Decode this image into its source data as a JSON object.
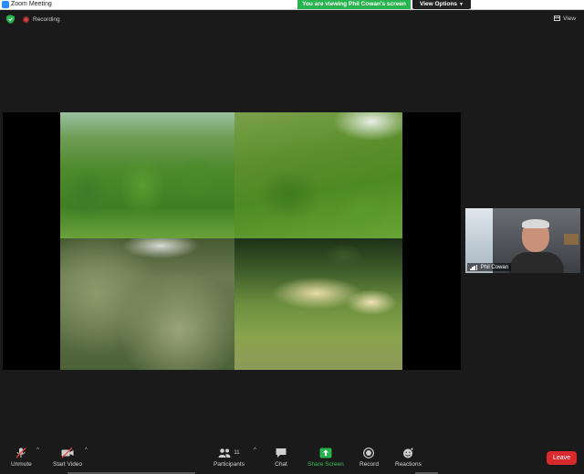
{
  "window": {
    "title": "Zoom Meeting"
  },
  "banner": {
    "text": "You are viewing Phil Cowan's screen"
  },
  "view_options": {
    "label": "View Options"
  },
  "top_bar": {
    "recording_label": "Recording",
    "view_label": "View"
  },
  "participant_video": {
    "name": "Phil Cowan"
  },
  "toolbar": {
    "unmute": "Unmute",
    "start_video": "Start Video",
    "participants": "Participants",
    "participants_count": "11",
    "chat": "Chat",
    "share_screen": "Share Screen",
    "record": "Record",
    "reactions": "Reactions",
    "leave": "Leave"
  },
  "colors": {
    "share_green": "#27b34d",
    "leave_red": "#d8292f",
    "recording_red": "#e04343"
  },
  "icons": [
    "zoom-app-icon",
    "shield-icon",
    "recording-dot-icon",
    "view-grid-icon",
    "muted-mic-icon",
    "stopped-video-icon",
    "participants-icon",
    "chat-icon",
    "share-screen-icon",
    "record-icon",
    "reactions-icon",
    "signal-icon"
  ]
}
